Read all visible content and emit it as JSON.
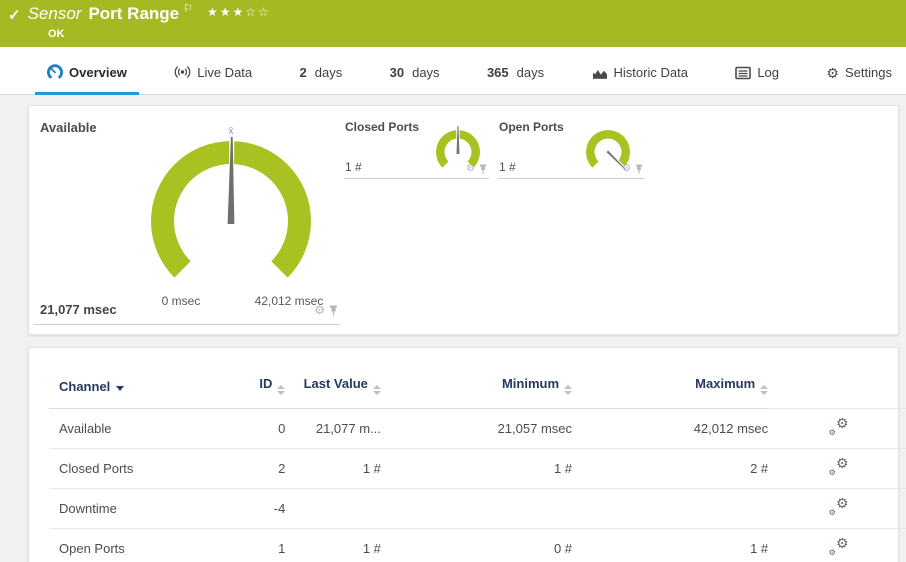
{
  "colors": {
    "header_green": "#a6b922",
    "gauge_green": "#a9c121",
    "tab_active_blue": "#1d9bd8",
    "table_header_navy": "#25395e"
  },
  "header": {
    "status_check_icon": "✓",
    "type_label": "Sensor",
    "name": "Port Range",
    "flag_icon": "⚐",
    "priority_stars": "★★★☆☆",
    "status": "OK"
  },
  "tabs": {
    "overview": {
      "label": "Overview",
      "icon": "gauge-icon",
      "active": true
    },
    "live_data": {
      "label": "Live Data",
      "icon": "live-icon"
    },
    "days2": {
      "num": "2",
      "label": "days"
    },
    "days30": {
      "num": "30",
      "label": "days"
    },
    "days365": {
      "num": "365",
      "label": "days"
    },
    "historic_data": {
      "label": "Historic Data",
      "icon": "area-chart-icon"
    },
    "log": {
      "label": "Log",
      "icon": "log-icon"
    },
    "settings": {
      "label": "Settings",
      "icon": "gear-icon",
      "gear_glyph": "⚙"
    }
  },
  "gauges": {
    "available": {
      "label": "Available",
      "value": "21,077 msec",
      "min_label": "0 msec",
      "max_label": "42,012 msec",
      "mean_marker": "x̄",
      "needle_percent": 50.2,
      "gear_icon": "⚙"
    },
    "closed_ports": {
      "label": "Closed Ports",
      "value": "1 #",
      "needle_percent": 50,
      "gear_icon": "⚙"
    },
    "open_ports": {
      "label": "Open Ports",
      "value": "1 #",
      "needle_percent": 100,
      "gear_icon": "⚙"
    }
  },
  "table": {
    "headers": {
      "channel": "Channel",
      "id": "ID",
      "last_value": "Last Value",
      "minimum": "Minimum",
      "maximum": "Maximum"
    },
    "rows": [
      {
        "channel": "Available",
        "id": "0",
        "last": "21,077 m...",
        "min": "21,057 msec",
        "max": "42,012 msec"
      },
      {
        "channel": "Closed Ports",
        "id": "2",
        "last": "1 #",
        "min": "1 #",
        "max": "2 #"
      },
      {
        "channel": "Downtime",
        "id": "-4",
        "last": "",
        "min": "",
        "max": ""
      },
      {
        "channel": "Open Ports",
        "id": "1",
        "last": "1 #",
        "min": "0 #",
        "max": "1 #"
      }
    ],
    "row_action_gear": "⚙"
  },
  "chart_data": [
    {
      "type": "gauge",
      "title": "Available",
      "unit": "msec",
      "min": 0,
      "max": 42012,
      "value": 21077,
      "minimum_seen": 21057,
      "maximum_seen": 42012
    },
    {
      "type": "gauge",
      "title": "Closed Ports",
      "unit": "#",
      "value": 1,
      "minimum_seen": 1,
      "maximum_seen": 2
    },
    {
      "type": "gauge",
      "title": "Open Ports",
      "unit": "#",
      "value": 1,
      "minimum_seen": 0,
      "maximum_seen": 1
    }
  ]
}
